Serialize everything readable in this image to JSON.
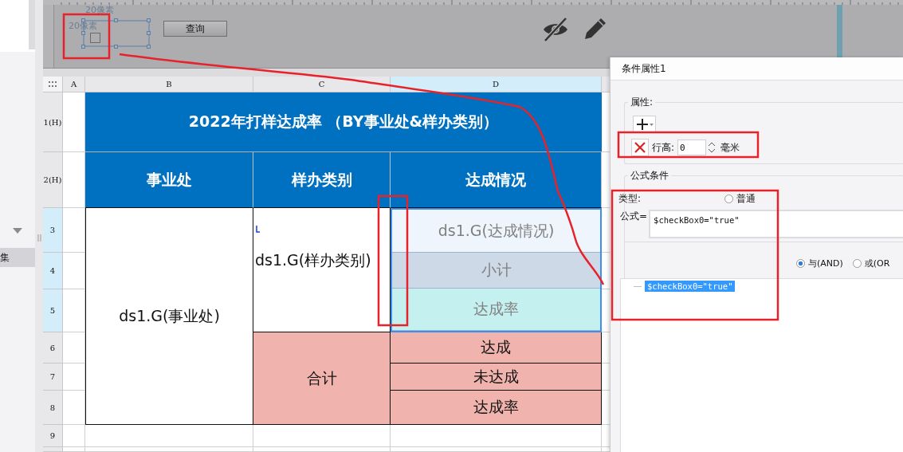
{
  "sidebar": {
    "items": [
      {
        "label": "集",
        "selected": true
      }
    ]
  },
  "canvas": {
    "labels": [
      "20像素",
      "20像素"
    ],
    "query_button": "查询"
  },
  "sheet": {
    "columns": [
      {
        "label": "A",
        "selected": false
      },
      {
        "label": "B",
        "selected": false
      },
      {
        "label": "C",
        "selected": false
      },
      {
        "label": "D",
        "selected": true
      }
    ],
    "rows": [
      {
        "label": "1(H)",
        "selected": false
      },
      {
        "label": "2(H)",
        "selected": false
      },
      {
        "label": "3",
        "selected": true
      },
      {
        "label": "4",
        "selected": true
      },
      {
        "label": "5",
        "selected": true
      },
      {
        "label": "6",
        "selected": false
      },
      {
        "label": "7",
        "selected": false
      },
      {
        "label": "8",
        "selected": false
      },
      {
        "label": "9",
        "selected": false
      }
    ],
    "title": "2022年打样达成率 （BY事业处&样办类别）",
    "headers": [
      "事业处",
      "样办类别",
      "达成情况"
    ],
    "group_cell": "ds1.G(事业处)",
    "category_cell": "ds1.G(样办类别)",
    "detail_cells": [
      {
        "text": "ds1.G(达成情况)",
        "color": "#eef5fc"
      },
      {
        "text": "小计",
        "color": "#cdd9e6"
      },
      {
        "text": "达成率",
        "color": "#c5f0f0"
      }
    ],
    "total_label": "合计",
    "total_cells": [
      "达成",
      "未达成",
      "达成率"
    ]
  },
  "panel": {
    "title": "条件属性1",
    "attributes_legend": "属性:",
    "row_height_label": "行高:",
    "row_height_value": "0",
    "unit": "毫米",
    "formula_legend": "公式条件",
    "type_label": "类型:",
    "type_option": {
      "label": "普通",
      "selected": false
    },
    "formula_label": "公式=",
    "formula": "$checkBox0=\"true\"",
    "logic_options": [
      {
        "label": "与(AND)",
        "selected": true
      },
      {
        "label": "或(OR",
        "selected": false
      }
    ],
    "conditions": [
      {
        "text": "$checkBox0=\"true\"",
        "selected": true
      }
    ]
  }
}
